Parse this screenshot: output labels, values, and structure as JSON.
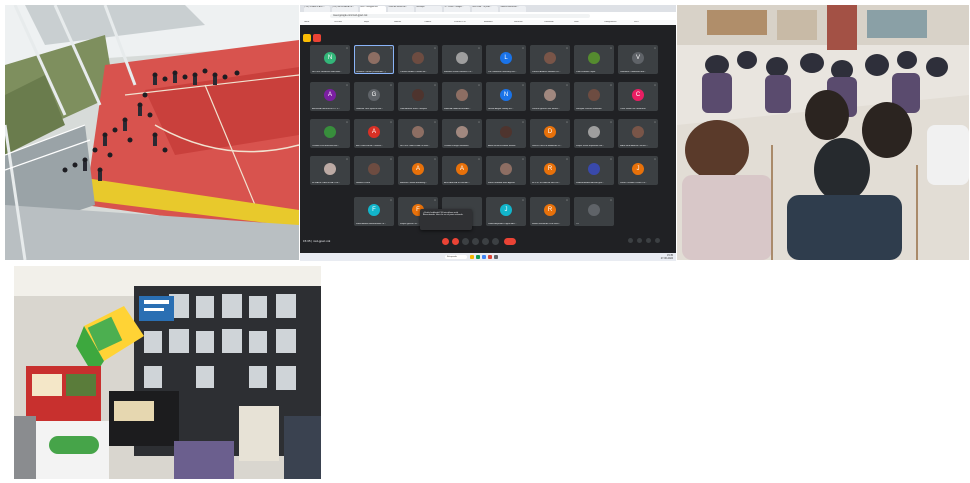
{
  "meet": {
    "tabs": [
      "(PDF) PLANIFICADO...",
      "(253) GEOGRAFIA DE...",
      "Meet - nxd-gpwr-mk",
      "Lunas de Mesas de...",
      "Mensajes",
      "RC: Lunas - Google...",
      "Meet PdM - Tu prob...",
      "Dominó Educación..."
    ],
    "url": "meet.google.com/nxd-gpwr-mk",
    "bookmarks": [
      "Gmail",
      "YouTube",
      "Maps",
      "Noticias",
      "Traducir",
      "PREPA CCFI",
      "Biblioteca",
      "Recursos",
      "Classroom",
      "Drive",
      "Configuración",
      "WPS"
    ],
    "participants": [
      {
        "initial": "N",
        "name": "NICOLE GENESIS MEDINA...",
        "color": "#33b679",
        "photo": false
      },
      {
        "initial": "",
        "name": "Giuliana Carrillo (Presentan...)",
        "color": "#8d6e63",
        "photo": true
      },
      {
        "initial": "",
        "name": "Yuriana Heberí Castillo Br...",
        "color": "#6d4c41",
        "photo": true
      },
      {
        "initial": "",
        "name": "Mariana Gisele Ramírez Ca...",
        "color": "#9e9e9e",
        "photo": true
      },
      {
        "initial": "L",
        "name": "Lus Guillermo Geovany Rui...",
        "color": "#1a73e8",
        "photo": false
      },
      {
        "initial": "",
        "name": "Patricia Andrea Saldaña Lo...",
        "color": "#795548",
        "photo": true
      },
      {
        "initial": "",
        "name": "Juan Esteban Tapia",
        "color": "#558b2f",
        "photo": true
      },
      {
        "initial": "V",
        "name": "Valentina Cuadrante Mar...",
        "color": "#5f6368",
        "photo": false
      },
      {
        "initial": "A",
        "name": "ANDREA DAVIDA SOTO V...",
        "color": "#7b1fa2",
        "photo": false
      },
      {
        "initial": "G",
        "name": "Gonzalo José Ignacio Mor...",
        "color": "#5f6368",
        "photo": false
      },
      {
        "initial": "",
        "name": "Lidia Andrea Sáez Vásquez",
        "color": "#4e342e",
        "photo": true
      },
      {
        "initial": "",
        "name": "KARINA GABRIELA MAR...",
        "color": "#8d6e63",
        "photo": true
      },
      {
        "initial": "N",
        "name": "Nicole Abigail Godoy Ro...",
        "color": "#1a73e8",
        "photo": false
      },
      {
        "initial": "",
        "name": "Javiera Ignacia San Martín...",
        "color": "#a1887f",
        "photo": true
      },
      {
        "initial": "",
        "name": "Sorayda Pereira González",
        "color": "#6d4c41",
        "photo": true
      },
      {
        "initial": "C",
        "name": "Carla Isabel Gil Zamorano",
        "color": "#e91e63",
        "photo": false
      },
      {
        "initial": "",
        "name": "Claudia Paz Marchant Mo...",
        "color": "#388e3c",
        "photo": true
      },
      {
        "initial": "A",
        "name": "ANTONELLA BETTINA M...",
        "color": "#d93025",
        "photo": false
      },
      {
        "initial": "",
        "name": "NICOLE CAROLINA VICIÑA...",
        "color": "#8d6e63",
        "photo": true
      },
      {
        "initial": "",
        "name": "Claudia Zúñiga Gonzalez",
        "color": "#a1887f",
        "photo": true
      },
      {
        "initial": "",
        "name": "Anita Nicole Escobar Muñoz",
        "color": "#4e342e",
        "photo": true
      },
      {
        "initial": "D",
        "name": "DIEGO FELIPE RAMÍREZ R...",
        "color": "#e8710a",
        "photo": false
      },
      {
        "initial": "",
        "name": "Felipe Josue Espinoza Gar...",
        "color": "#9e9e9e",
        "photo": true
      },
      {
        "initial": "",
        "name": "RAUL ALEJANDRO ROA L...",
        "color": "#795548",
        "photo": true
      },
      {
        "initial": "",
        "name": "ROSALIE CAROLINA TOR...",
        "color": "#bcaaa4",
        "photo": true
      },
      {
        "initial": "",
        "name": "Natalia Lucero",
        "color": "#6d4c41",
        "photo": true
      },
      {
        "initial": "A",
        "name": "Bárbara Camila Bombarig...",
        "color": "#e8710a",
        "photo": false
      },
      {
        "initial": "A",
        "name": "ALEXANDRA SOLEDAD...",
        "color": "#e8710a",
        "photo": false
      },
      {
        "initial": "",
        "name": "María Soledad Ríos Aguirre",
        "color": "#8d6e63",
        "photo": true
      },
      {
        "initial": "R",
        "name": "ROCIO SOLANGE REYES...",
        "color": "#e8710a",
        "photo": false
      },
      {
        "initial": "",
        "name": "Isabela Andrea Acosta gua...",
        "color": "#3949ab",
        "photo": true
      },
      {
        "initial": "J",
        "name": "Javier Osvaldo Castro Ca...",
        "color": "#e8710a",
        "photo": false
      },
      {
        "initial": "F",
        "name": "Febe Andrea Bahamonde Zu...",
        "color": "#12b5cb",
        "photo": false
      },
      {
        "initial": "F",
        "name": "Felipe Ignacio Ju...",
        "color": "#e8710a",
        "photo": false
      },
      {
        "initial": "",
        "name": "",
        "color": "#3c4043",
        "photo": false
      },
      {
        "initial": "J",
        "name": "Jamie Alejandra Olguín Ara...",
        "color": "#12b5cb",
        "photo": false
      },
      {
        "initial": "R",
        "name": "Rafael Fernando Cruz Mun...",
        "color": "#e8710a",
        "photo": false
      },
      {
        "initial": "",
        "name": "Tú",
        "color": "#5f6368",
        "photo": true
      }
    ],
    "toast": "¿Estás hablando? El micrófono está desactivado. Haz clic en el para activarlo.",
    "meeting_code": "15:35 | nxd-gpwr-mk",
    "taskbar": {
      "search": "Búsqueda",
      "time": "15:35",
      "date": "27-06-2024"
    }
  }
}
